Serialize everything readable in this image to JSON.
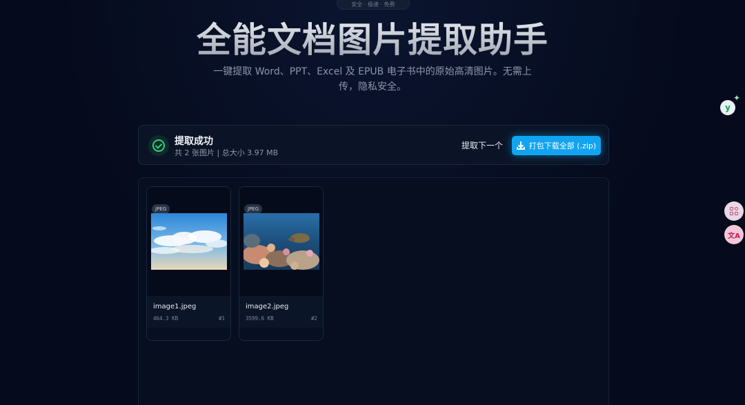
{
  "header": {
    "pill": "安全 · 极速 · 免费",
    "title": "全能文档图片提取助手",
    "subtitle": "一键提取 Word、PPT、Excel 及 EPUB 电子书中的原始高清图片。无需上传，隐私安全。"
  },
  "status": {
    "title": "提取成功",
    "meta": "共 2 张图片 | 总大小 3.97 MB",
    "next_label": "提取下一个",
    "zip_label": "打包下载全部 (.zip)"
  },
  "images": [
    {
      "format": "JPEG",
      "name": "image1.jpeg",
      "size": "464.3 KB",
      "index": "#1"
    },
    {
      "format": "JPEG",
      "name": "image2.jpeg",
      "size": "3599.6 KB",
      "index": "#2"
    }
  ],
  "side_tools": {
    "y_label": "y",
    "sparkle": "✦",
    "translate_label": "文A"
  },
  "icons": {
    "success": "check-circle-icon",
    "download": "download-icon",
    "sidebar": [
      "assistant-icon",
      "apps-icon",
      "translate-icon"
    ]
  },
  "colors": {
    "background": "#050b1c",
    "accent": "#11a4f0",
    "success": "#2fd27a"
  }
}
